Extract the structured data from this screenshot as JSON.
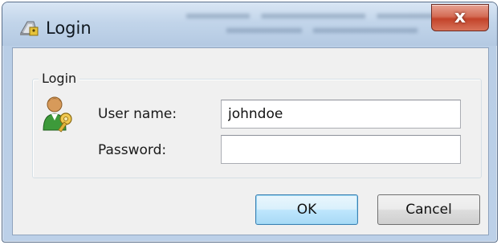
{
  "window": {
    "title": "Login",
    "close_label": "x"
  },
  "group": {
    "label": "Login"
  },
  "fields": {
    "username_label": "User name:",
    "username_value": "johndoe",
    "password_label": "Password:",
    "password_value": ""
  },
  "buttons": {
    "ok_label": "OK",
    "cancel_label": "Cancel"
  },
  "icons": {
    "title": "login-key-icon",
    "user": "user-key-icon",
    "close": "close-icon"
  },
  "colors": {
    "close_button": "#c3432a",
    "default_button_border": "#3c7fb1"
  }
}
